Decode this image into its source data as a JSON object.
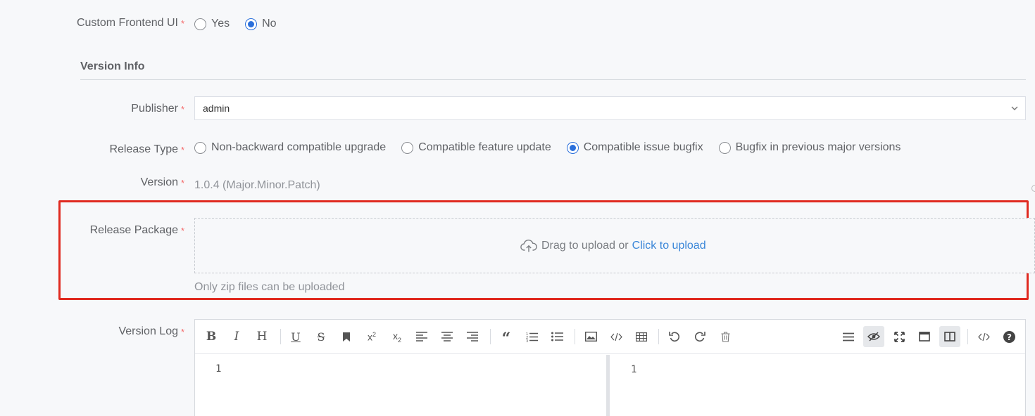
{
  "custom_frontend": {
    "label": "Custom Frontend UI",
    "required": "*",
    "options": [
      {
        "label": "Yes",
        "checked": false
      },
      {
        "label": "No",
        "checked": true
      }
    ]
  },
  "version_info": {
    "title": "Version Info"
  },
  "publisher": {
    "label": "Publisher",
    "required": "*",
    "value": "admin"
  },
  "release_type": {
    "label": "Release Type",
    "required": "*",
    "options": [
      {
        "label": "Non-backward compatible upgrade",
        "checked": false
      },
      {
        "label": "Compatible feature update",
        "checked": false
      },
      {
        "label": "Compatible issue bugfix",
        "checked": true
      },
      {
        "label": "Bugfix in previous major versions",
        "checked": false
      }
    ]
  },
  "version": {
    "label": "Version",
    "required": "*",
    "value": "1.0.4 (Major.Minor.Patch)"
  },
  "release_package": {
    "label": "Release Package",
    "required": "*",
    "drag_text": "Drag to upload or",
    "click_text": "Click to upload",
    "hint": "Only zip files can be uploaded"
  },
  "version_log": {
    "label": "Version Log",
    "required": "*",
    "left_line": "1",
    "right_line": "1",
    "toolbar_left": [
      "bold-icon",
      "italic-icon",
      "heading-icon",
      "underline-icon",
      "strikethrough-icon",
      "bookmark-icon",
      "superscript-icon",
      "subscript-icon",
      "align-left-icon",
      "align-center-icon",
      "align-right-icon",
      "quote-icon",
      "ordered-list-icon",
      "unordered-list-icon",
      "image-icon",
      "code-icon",
      "table-icon",
      "undo-icon",
      "redo-icon",
      "trash-icon"
    ],
    "toolbar_right": [
      "navigation-icon",
      "preview-toggle-icon",
      "fullscreen-icon",
      "window-fullscreen-icon",
      "split-view-icon",
      "html-preview-icon",
      "help-icon"
    ]
  },
  "colors": {
    "accent": "#2a6fdb",
    "required": "#f56c6c",
    "highlight": "#e02a20",
    "link": "#3a86d8"
  }
}
